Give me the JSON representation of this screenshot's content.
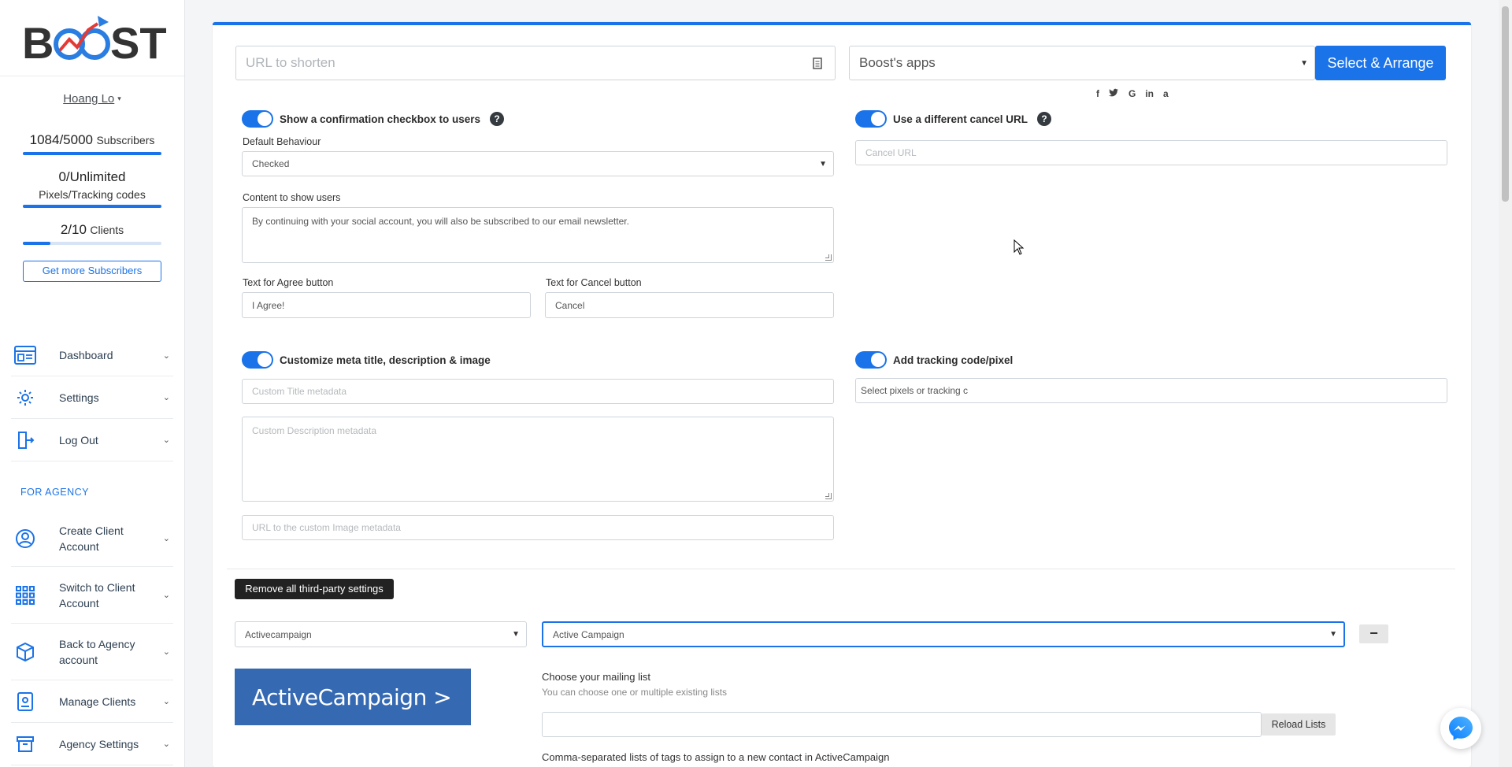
{
  "brand": {
    "logo_text": "BOOST",
    "accent": "#1a73e8"
  },
  "sidebar": {
    "user_name": "Hoang Lo",
    "user_caret": "▾",
    "stats": {
      "subscribers_count": "1084/5000",
      "subscribers_label": "Subscribers",
      "pixels_count": "0/Unlimited",
      "pixels_label": "Pixels/Tracking codes",
      "clients_count": "2/10",
      "clients_label": "Clients",
      "clients_fraction": 0.2
    },
    "get_more_label": "Get more Subscribers",
    "items": [
      {
        "label": "Dashboard",
        "icon": "dashboard-icon"
      },
      {
        "label": "Settings",
        "icon": "gear-icon"
      },
      {
        "label": "Log Out",
        "icon": "logout-icon"
      }
    ],
    "agency_section_label": "FOR AGENCY",
    "agency_items": [
      {
        "label": "Create Client Account",
        "icon": "user-circle-icon"
      },
      {
        "label": "Switch to Client Account",
        "icon": "grid-icon"
      },
      {
        "label": "Back to Agency account",
        "icon": "box-icon"
      },
      {
        "label": "Manage Clients",
        "icon": "id-badge-icon"
      },
      {
        "label": "Agency Settings",
        "icon": "archive-icon"
      }
    ]
  },
  "main": {
    "url_input_placeholder": "URL to shorten",
    "apps_select_value": "Boost's apps",
    "select_arrange_label": "Select & Arrange",
    "social_icons": [
      "f",
      "🐦",
      "G",
      "in",
      "a"
    ],
    "confirm_toggle_label": "Show a confirmation checkbox to users",
    "default_behaviour_label": "Default Behaviour",
    "default_behaviour_value": "Checked",
    "content_label": "Content to show users",
    "content_value": "By continuing with your social account, you will also be subscribed to our email newsletter.",
    "agree_label": "Text for Agree button",
    "agree_value": "I Agree!",
    "cancel_label": "Text for Cancel button",
    "cancel_value": "Cancel",
    "cancel_url_toggle_label": "Use a different cancel URL",
    "cancel_url_placeholder": "Cancel URL",
    "meta_toggle_label": "Customize meta title, description & image",
    "meta_title_placeholder": "Custom Title metadata",
    "meta_desc_placeholder": "Custom Description metadata",
    "meta_image_placeholder": "URL to the custom Image metadata",
    "tracking_toggle_label": "Add tracking code/pixel",
    "tracking_placeholder": "Select pixels or tracking c",
    "help_glyph": "?",
    "remove_third_party_label": "Remove all third-party settings",
    "integration_select_value": "Activecampaign",
    "account_select_value": "Active Campaign",
    "minus_glyph": "−",
    "ac_logo_text": "ActiveCampaign >",
    "mailing_list_label": "Choose your mailing list",
    "mailing_list_hint": "You can choose one or multiple existing lists",
    "reload_lists_label": "Reload Lists",
    "tags_label": "Comma-separated lists of tags to assign to a new contact in ActiveCampaign"
  }
}
